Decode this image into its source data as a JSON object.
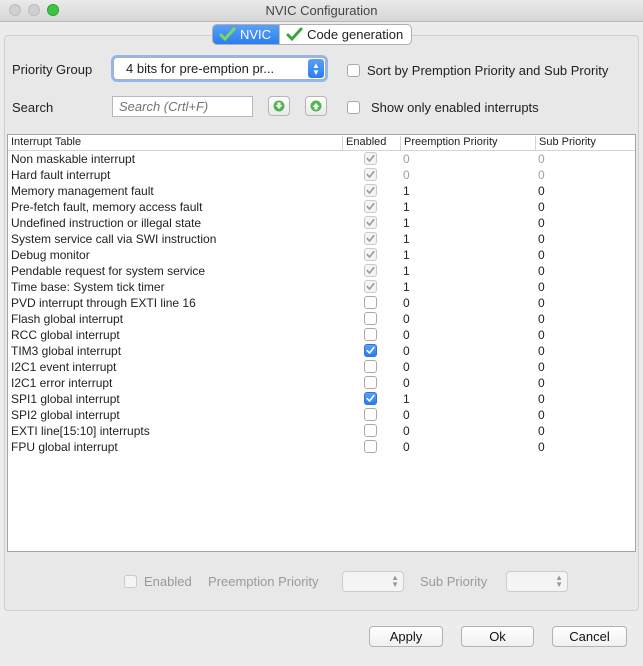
{
  "window": {
    "title": "NVIC Configuration"
  },
  "tabs": [
    {
      "label": "NVIC",
      "active": true
    },
    {
      "label": "Code generation",
      "active": false
    }
  ],
  "priority_group": {
    "label": "Priority Group",
    "value": "4 bits for pre-emption pr..."
  },
  "sort_option": {
    "label": "Sort by Premption Priority and Sub Prority",
    "checked": false
  },
  "search": {
    "label": "Search",
    "placeholder": "Search (Crtl+F)"
  },
  "show_enabled_option": {
    "label": "Show only enabled interrupts",
    "checked": false
  },
  "table": {
    "headers": [
      "Interrupt Table",
      "Enabled",
      "Preemption Priority",
      "Sub Priority"
    ],
    "rows": [
      {
        "name": "Non maskable interrupt",
        "enabled": "locked",
        "preemption": "0",
        "sub": "0",
        "grey": true
      },
      {
        "name": "Hard fault interrupt",
        "enabled": "locked",
        "preemption": "0",
        "sub": "0",
        "grey": true
      },
      {
        "name": "Memory management fault",
        "enabled": "locked",
        "preemption": "1",
        "sub": "0",
        "grey": false
      },
      {
        "name": "Pre-fetch fault, memory access fault",
        "enabled": "locked",
        "preemption": "1",
        "sub": "0",
        "grey": false
      },
      {
        "name": "Undefined instruction or illegal state",
        "enabled": "locked",
        "preemption": "1",
        "sub": "0",
        "grey": false
      },
      {
        "name": "System service call via SWI instruction",
        "enabled": "locked",
        "preemption": "1",
        "sub": "0",
        "grey": false
      },
      {
        "name": "Debug monitor",
        "enabled": "locked",
        "preemption": "1",
        "sub": "0",
        "grey": false
      },
      {
        "name": "Pendable request for system service",
        "enabled": "locked",
        "preemption": "1",
        "sub": "0",
        "grey": false
      },
      {
        "name": "Time base: System tick timer",
        "enabled": "locked",
        "preemption": "1",
        "sub": "0",
        "grey": false
      },
      {
        "name": "PVD interrupt through EXTI line 16",
        "enabled": "off",
        "preemption": "0",
        "sub": "0",
        "grey": false
      },
      {
        "name": "Flash global interrupt",
        "enabled": "off",
        "preemption": "0",
        "sub": "0",
        "grey": false
      },
      {
        "name": "RCC global interrupt",
        "enabled": "off",
        "preemption": "0",
        "sub": "0",
        "grey": false
      },
      {
        "name": "TIM3 global interrupt",
        "enabled": "on",
        "preemption": "0",
        "sub": "0",
        "grey": false
      },
      {
        "name": "I2C1 event interrupt",
        "enabled": "off",
        "preemption": "0",
        "sub": "0",
        "grey": false
      },
      {
        "name": "I2C1 error interrupt",
        "enabled": "off",
        "preemption": "0",
        "sub": "0",
        "grey": false
      },
      {
        "name": "SPI1 global interrupt",
        "enabled": "on",
        "preemption": "1",
        "sub": "0",
        "grey": false
      },
      {
        "name": "SPI2 global interrupt",
        "enabled": "off",
        "preemption": "0",
        "sub": "0",
        "grey": false
      },
      {
        "name": "EXTI line[15:10] interrupts",
        "enabled": "off",
        "preemption": "0",
        "sub": "0",
        "grey": false
      },
      {
        "name": "FPU global interrupt",
        "enabled": "off",
        "preemption": "0",
        "sub": "0",
        "grey": false
      }
    ]
  },
  "detail": {
    "enabled_label": "Enabled",
    "preemption_label": "Preemption Priority",
    "sub_label": "Sub Priority"
  },
  "buttons": {
    "apply": "Apply",
    "ok": "Ok",
    "cancel": "Cancel"
  },
  "colors": {
    "accent": "#2a7ef0",
    "check_green": "#3aa33a"
  }
}
